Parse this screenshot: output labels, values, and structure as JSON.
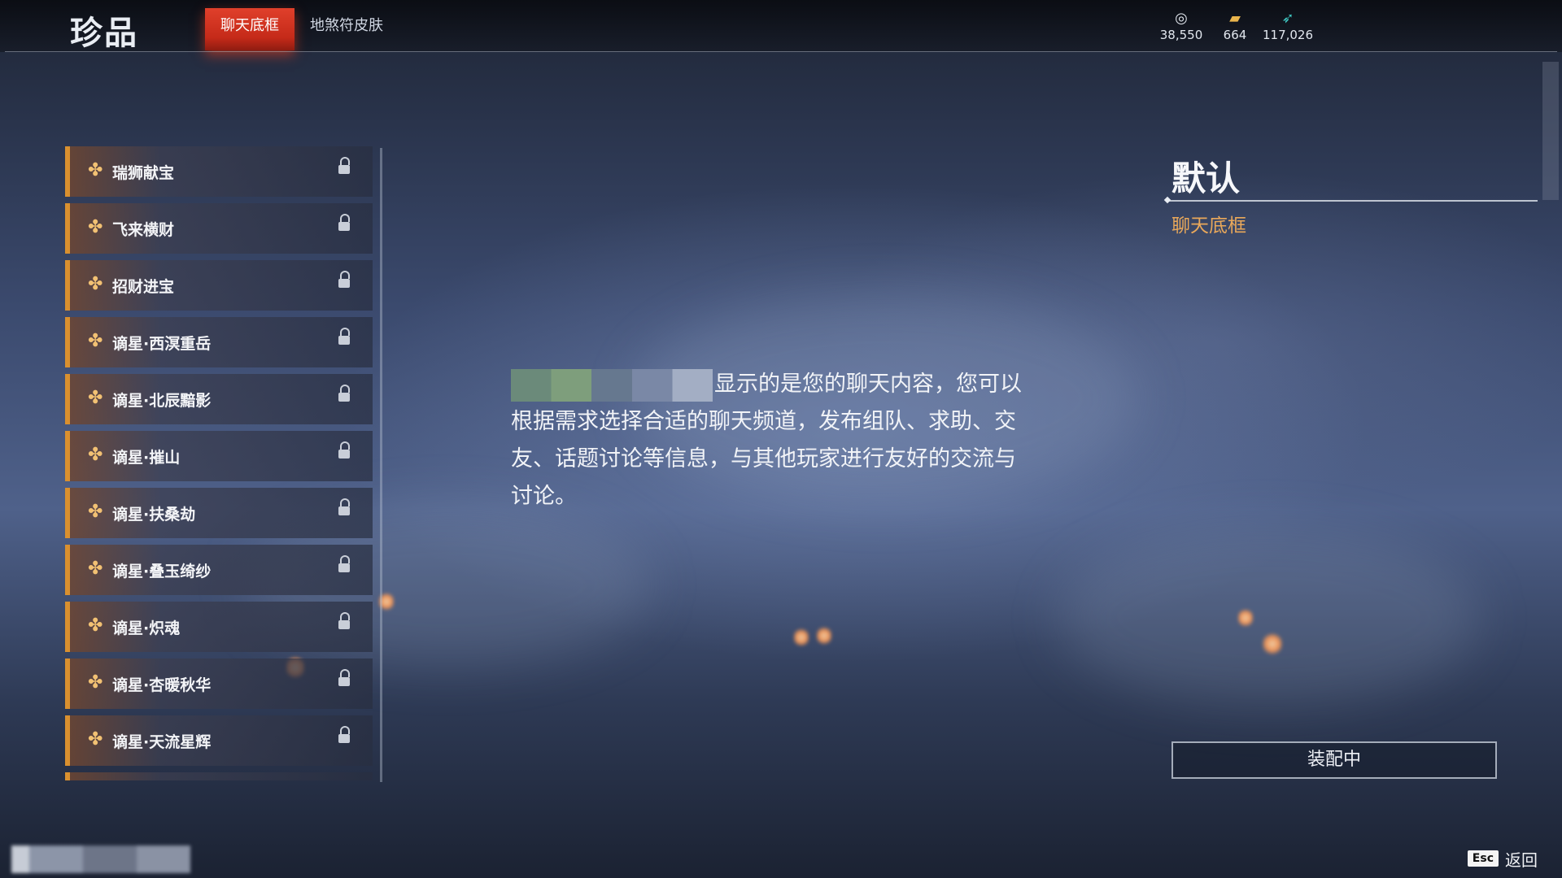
{
  "header": {
    "title": "珍品",
    "tabs": [
      {
        "label": "聊天底框",
        "active": true
      },
      {
        "label": "地煞符皮肤",
        "active": false
      }
    ],
    "currencies": [
      {
        "icon": "coin-icon",
        "value": "38,550"
      },
      {
        "icon": "ticket-icon",
        "value": "664"
      },
      {
        "icon": "feather-icon",
        "value": "117,026"
      }
    ]
  },
  "list": {
    "items": [
      {
        "label": "瑞狮献宝"
      },
      {
        "label": "飞来横财"
      },
      {
        "label": "招财进宝"
      },
      {
        "label": "谪星·西溟重岳"
      },
      {
        "label": "谪星·北辰黯影"
      },
      {
        "label": "谪星·摧山"
      },
      {
        "label": "谪星·扶桑劫"
      },
      {
        "label": "谪星·叠玉绮纱"
      },
      {
        "label": "谪星·炽魂"
      },
      {
        "label": "谪星·杏暖秋华"
      },
      {
        "label": "谪星·天流星辉"
      }
    ]
  },
  "preview": {
    "text": "显示的是您的聊天内容，您可以根据需求选择合适的聊天频道，发布组队、求助、交友、话题讨论等信息，与其他玩家进行友好的交流与讨论。"
  },
  "detail": {
    "title": "默认",
    "subtitle": "聊天底框",
    "equip_label": "装配中"
  },
  "footer": {
    "esc_key": "Esc",
    "back_label": "返回"
  },
  "colors": {
    "accent_red": "#d9382a",
    "accent_orange": "#d9902f",
    "subtitle_gold": "#e9a85a"
  }
}
